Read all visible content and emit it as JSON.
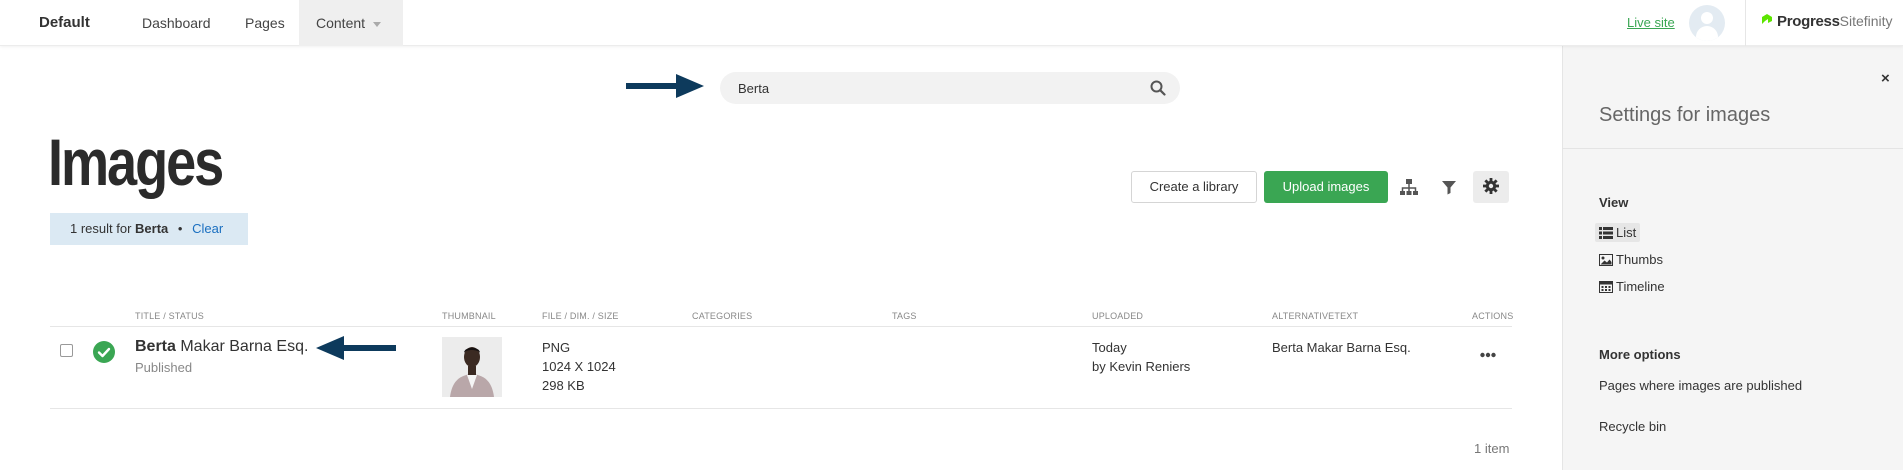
{
  "nav": {
    "site_name": "Default",
    "items": [
      {
        "label": "Dashboard"
      },
      {
        "label": "Pages"
      },
      {
        "label": "Content"
      }
    ],
    "live_site": "Live site",
    "brand_progress": "Progress",
    "brand_sitefinity": "Sitefinity",
    "icons": {
      "avatar": "user-avatar-icon",
      "brand": "progress-leaf-icon"
    }
  },
  "search": {
    "value": "Berta",
    "icon": "search-icon"
  },
  "page": {
    "title": "Images",
    "result_prefix": "1 result for",
    "result_term": "Berta",
    "result_separator": "•",
    "clear_label": "Clear"
  },
  "toolbar": {
    "create_library": "Create a library",
    "upload_images": "Upload images",
    "icons": [
      "hierarchy-icon",
      "filter-icon",
      "gear-icon"
    ]
  },
  "table": {
    "headers": {
      "title": "TITLE / STATUS",
      "thumbnail": "THUMBNAIL",
      "file": "FILE / DIM. / SIZE",
      "categories": "CATEGORIES",
      "tags": "TAGS",
      "uploaded": "UPLOADED",
      "alt": "ALTERNATIVETEXT",
      "actions": "ACTIONS"
    },
    "rows": [
      {
        "title_bold": "Berta",
        "title_rest": " Makar Barna Esq.",
        "status": "Published",
        "file_type": "PNG",
        "dimensions": "1024 X 1024",
        "size": "298 KB",
        "uploaded_when": "Today",
        "uploaded_by": "by Kevin Reniers",
        "alt_text": "Berta Makar Barna Esq."
      }
    ],
    "item_count": "1 item"
  },
  "panel": {
    "title": "Settings for images",
    "close": "×",
    "view_label": "View",
    "view_options": [
      {
        "label": "List",
        "icon": "list-icon",
        "active": true
      },
      {
        "label": "Thumbs",
        "icon": "image-icon",
        "active": false
      },
      {
        "label": "Timeline",
        "icon": "calendar-icon",
        "active": false
      }
    ],
    "more_label": "More options",
    "pages_published": "Pages where images are published",
    "recycle_bin": "Recycle bin"
  },
  "colors": {
    "accent_green": "#3aa653",
    "arrow_navy": "#0d3a5c",
    "banner_blue": "#dbe9f3",
    "link_blue": "#1a6fc0"
  }
}
